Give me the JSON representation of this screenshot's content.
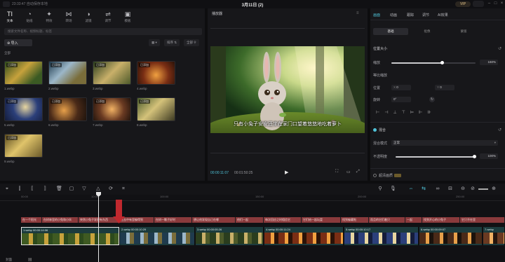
{
  "titlebar": {
    "app_name": "23:33:47 自动保存本地",
    "doc_title": "3月11日 (2)",
    "vip_label": "VIP",
    "share_label": "分享",
    "min_icon": "minimize-icon",
    "max_icon": "maximize-icon",
    "close_icon": "close-icon"
  },
  "media_toolbar": [
    {
      "label": "文本",
      "icon": "TI"
    },
    {
      "label": "贴纸",
      "icon": "◔"
    },
    {
      "label": "特效",
      "icon": "✦"
    },
    {
      "label": "转场",
      "icon": "⋈"
    },
    {
      "label": "滤镜",
      "icon": "◑"
    },
    {
      "label": "调节",
      "icon": "⇌"
    },
    {
      "label": "模板",
      "icon": "▣"
    }
  ],
  "media": {
    "search_placeholder": "搜索文件名称、视频标题、标签",
    "import_label": "导入",
    "sort_label": "排序",
    "filter_label": "全部",
    "all_label": "全部",
    "items": [
      {
        "name": "1.webp",
        "tag": "已添加"
      },
      {
        "name": "2.webp",
        "tag": "已添加"
      },
      {
        "name": "3.webp",
        "tag": "已添加"
      },
      {
        "name": "4.webp",
        "tag": "已添加"
      },
      {
        "name": "5.webp",
        "tag": "已添加"
      },
      {
        "name": "6.webp",
        "tag": "已添加"
      },
      {
        "name": "7.webp",
        "tag": "已添加"
      },
      {
        "name": "8.webp",
        "tag": "已添加"
      },
      {
        "name": "9.webp",
        "tag": "已添加"
      }
    ]
  },
  "player": {
    "header": "播放器",
    "subtitle": "只有小兔子安安还坐在家门口望着悠悠地吃着萝卜",
    "current_time": "00:00:11:07",
    "total_time": "00:01:50:25"
  },
  "inspector": {
    "tabs": [
      "画面",
      "动画",
      "跟踪",
      "调节",
      "AI效果"
    ],
    "subtabs": [
      "基础",
      "抠像",
      "蒙版"
    ],
    "position_size_label": "位置大小",
    "scale_label": "缩放",
    "scale_value": "160%",
    "scale_fraction": 0.6,
    "uniform_scale_label": "等比缩放",
    "position_label": "位置",
    "pos_x_prefix": "X",
    "pos_x": "0",
    "pos_y_prefix": "Y",
    "pos_y": "0",
    "rotate_label": "旋转",
    "rotate_value": "0°",
    "blend_label": "混合",
    "blend_mode_label": "混合模式",
    "blend_mode_value": "正常",
    "opacity_label": "不透明度",
    "opacity_value": "100%",
    "opacity_fraction": 1.0,
    "enhance_label": "超清画质"
  },
  "timeline": {
    "ruler_marks": [
      "00:00",
      "10:00",
      "100:00",
      "150:00",
      "200:00",
      "250:00"
    ],
    "subtitle_clips": [
      "在一个阳光",
      "在树林里的小兔和小伙",
      "突然小兔子发现有东西",
      "在丛中有里躲得到",
      "在树一颗子好时",
      "想让他发现自己在哪",
      "他们一起",
      "每次回应之时相信它",
      "它们给一起玩耍",
      "找到躲藏啦",
      "而且的它们着只",
      "一起",
      "找到开心的小兔子",
      "它只不在里"
    ],
    "video_clips": [
      {
        "name": "1.webp",
        "dur": "00:00:14:06"
      },
      {
        "name": "2.webp",
        "dur": "00:00:10:29"
      },
      {
        "name": "3.webp",
        "dur": "00:00:05:26"
      },
      {
        "name": "4.webp",
        "dur": "00:00:11:24"
      },
      {
        "name": "5.webp",
        "dur": "00:00:10:17"
      },
      {
        "name": "6.webp",
        "dur": "00:00:09:07"
      },
      {
        "name": "7.webp",
        "dur": ""
      }
    ],
    "cover_label": "封面"
  }
}
